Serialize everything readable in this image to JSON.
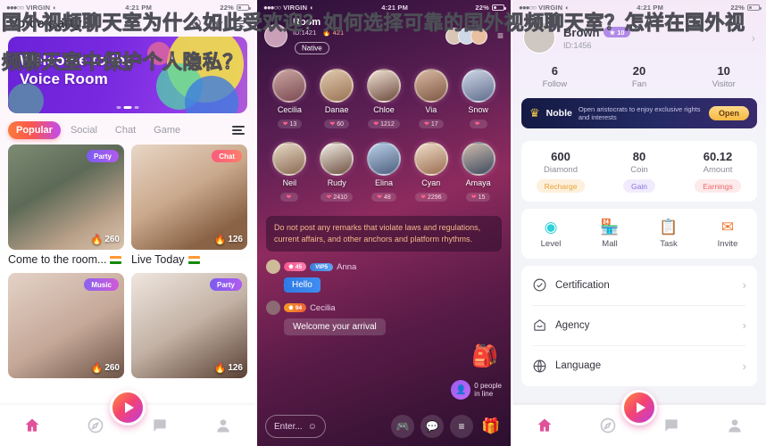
{
  "overlay": {
    "headline": "国外视频聊天室为什么如此受欢迎？如何选择可靠的国外视频聊天室？怎样在国外视频聊天室中保护个人隐私？"
  },
  "status_bar": {
    "carrier": "VIRGIN",
    "time": "4:21 PM",
    "battery": "22%"
  },
  "panel_list": {
    "title": "Voice party",
    "icons": {
      "search": "search-icon",
      "star": "star-icon",
      "menu": "menu-icon"
    },
    "banner": {
      "line1": "Welcome to the",
      "line2": "Voice Room"
    },
    "tabs": [
      {
        "label": "Popular",
        "active": true
      },
      {
        "label": "Social",
        "active": false
      },
      {
        "label": "Chat",
        "active": false
      },
      {
        "label": "Game",
        "active": false
      }
    ],
    "cards": [
      {
        "tag": "Party",
        "tag_type": "party",
        "count": "260",
        "title": "Come to the room...",
        "flag": "india-flag-icon"
      },
      {
        "tag": "Chat",
        "tag_type": "chat",
        "count": "126",
        "title": "Live Today",
        "flag": "india-flag-icon"
      },
      {
        "tag": "Music",
        "tag_type": "music",
        "count": "260",
        "title": "",
        "flag": ""
      },
      {
        "tag": "Party",
        "tag_type": "party",
        "count": "126",
        "title": "",
        "flag": ""
      }
    ],
    "bottom_nav": [
      {
        "name": "home",
        "icon": "home-icon",
        "active": true
      },
      {
        "name": "discover",
        "icon": "globe-icon",
        "active": false
      },
      {
        "name": "live",
        "icon": "play-icon",
        "active": false
      },
      {
        "name": "messages",
        "icon": "chat-icon",
        "active": false
      },
      {
        "name": "profile",
        "icon": "person-icon",
        "active": false
      }
    ]
  },
  "panel_room": {
    "room_name": "Room",
    "room_id": "ID:1421",
    "heat": "421",
    "follow_label": "Native",
    "seats": [
      {
        "name": "Cecilia",
        "count": "13"
      },
      {
        "name": "Danae",
        "count": "60"
      },
      {
        "name": "Chloe",
        "count": "1212"
      },
      {
        "name": "Via",
        "count": "17"
      },
      {
        "name": "Snow",
        "count": ""
      },
      {
        "name": "Neil",
        "count": ""
      },
      {
        "name": "Rudy",
        "count": "2410"
      },
      {
        "name": "Elina",
        "count": "48"
      },
      {
        "name": "Cyan",
        "count": "2296"
      },
      {
        "name": "Amaya",
        "count": "15"
      }
    ],
    "notice": "Do not post any remarks that violate laws and regulations, current affairs, and other anchors and platform rhythms.",
    "messages": [
      {
        "level": "45",
        "vip": "VIP5",
        "name": "Anna",
        "text": "Hello",
        "style": "blue"
      },
      {
        "level": "94",
        "vip": "",
        "name": "Cecilia",
        "text": "Welcome your arrival",
        "style": "grey"
      }
    ],
    "queue": {
      "line1": "0 people",
      "line2": "in line"
    },
    "chest_icon": "treasure-chest-icon",
    "input_placeholder": "Enter...",
    "bottom_icons": [
      {
        "name": "emoji",
        "icon": "emoji-icon"
      },
      {
        "name": "game",
        "icon": "game-controller-icon"
      },
      {
        "name": "message",
        "icon": "chat-bubble-icon"
      },
      {
        "name": "more",
        "icon": "menu-icon"
      },
      {
        "name": "gift",
        "icon": "gift-icon"
      }
    ]
  },
  "panel_profile": {
    "user": {
      "name": "Brown",
      "level": "10",
      "id": "ID:1456"
    },
    "stats": [
      {
        "value": "6",
        "label": "Follow"
      },
      {
        "value": "20",
        "label": "Fan"
      },
      {
        "value": "10",
        "label": "Visitor"
      }
    ],
    "noble": {
      "title": "Noble",
      "desc": "Open aristocrats to enjoy exclusive rights and interests",
      "button": "Open",
      "icon": "crown-icon"
    },
    "wallet": [
      {
        "value": "600",
        "label": "Diamond",
        "action": "Recharge"
      },
      {
        "value": "80",
        "label": "Coin",
        "action": "Gain"
      },
      {
        "value": "60.12",
        "label": "Amount",
        "action": "Earnings"
      }
    ],
    "quick_actions": [
      {
        "label": "Level",
        "icon": "level-icon"
      },
      {
        "label": "Mall",
        "icon": "store-icon"
      },
      {
        "label": "Task",
        "icon": "clipboard-icon"
      },
      {
        "label": "Invite",
        "icon": "envelope-icon"
      }
    ],
    "list_items": [
      {
        "label": "Certification",
        "icon": "verified-badge-icon"
      },
      {
        "label": "Agency",
        "icon": "house-icon"
      },
      {
        "label": "Language",
        "icon": "globe-icon"
      }
    ],
    "bottom_nav": [
      {
        "name": "home",
        "icon": "home-icon",
        "active": true
      },
      {
        "name": "discover",
        "icon": "globe-icon",
        "active": false
      },
      {
        "name": "live",
        "icon": "play-icon",
        "active": false
      },
      {
        "name": "messages",
        "icon": "chat-icon",
        "active": false
      },
      {
        "name": "profile",
        "icon": "person-icon",
        "active": false
      }
    ]
  },
  "colors": {
    "accent_pink": "#e0529a",
    "accent_orange": "#fb7a3c",
    "tab_active_gradient_start": "#fb7a3c",
    "tab_active_gradient_end": "#c24cf0",
    "noble_bg": "#141a43",
    "noble_btn": "#f5b942"
  }
}
